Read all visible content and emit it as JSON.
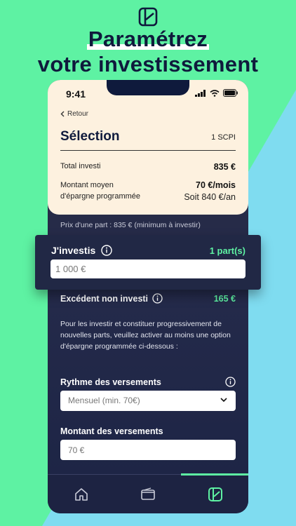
{
  "headline": {
    "line1": "Paramétrez",
    "line2": "votre investissement"
  },
  "status_bar": {
    "time": "9:41"
  },
  "nav": {
    "back_label": "Retour"
  },
  "selection": {
    "title": "Sélection",
    "count": "1 SCPI",
    "total_label": "Total investi",
    "total_value": "835 €",
    "monthly_label_1": "Montant moyen",
    "monthly_label_2": "d'épargne programmée",
    "monthly_value": "70 €/mois",
    "yearly_value": "Soit 840 €/an"
  },
  "price_note": "Prix d'une part : 835 € (minimum à investir)",
  "invest": {
    "label": "J'investis",
    "parts": "1 part(s)",
    "value": "1 000 €"
  },
  "excedent": {
    "label": "Excédent non investi",
    "value": "165 €"
  },
  "paragraph": "Pour les investir et constituer progressivement de nouvelles parts, veuillez activer au moins une option d'épargne programmée ci-dessous :",
  "rythme": {
    "label": "Rythme des versements",
    "selected": "Mensuel (min. 70€)"
  },
  "montant": {
    "label": "Montant des versements",
    "placeholder": "70 €"
  },
  "colors": {
    "green": "#5ef2a3",
    "blue": "#7fdcf0",
    "navy": "#0f1a3c",
    "cream": "#fdf1df"
  },
  "tabs": {
    "icons": [
      "home-icon",
      "wallet-icon",
      "app-logo-icon"
    ],
    "active": 2
  }
}
